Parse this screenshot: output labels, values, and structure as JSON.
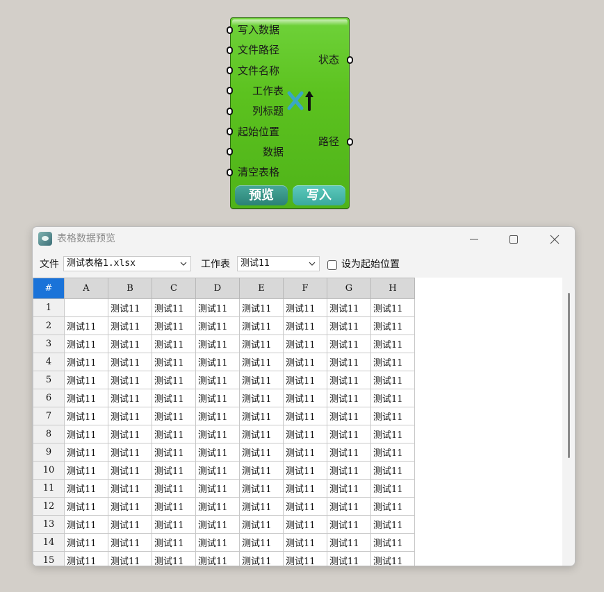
{
  "component": {
    "inputs": [
      "写入数据",
      "文件路径",
      "文件名称",
      "工作表",
      "列标题",
      "起始位置",
      "数据",
      "清空表格"
    ],
    "outputs": [
      "状态",
      "路径"
    ],
    "buttons": {
      "preview": "预览",
      "write": "写入"
    }
  },
  "window": {
    "title": "表格数据预览",
    "file_label": "文件",
    "file_value": "测试表格1.xlsx",
    "sheet_label": "工作表",
    "sheet_value": "测试11",
    "start_checkbox_label": "设为起始位置",
    "start_checkbox_checked": false
  },
  "grid": {
    "corner": "#",
    "columns": [
      "A",
      "B",
      "C",
      "D",
      "E",
      "F",
      "G",
      "H"
    ],
    "rows": [
      {
        "num": "1",
        "cells": [
          "",
          "测试11",
          "测试11",
          "测试11",
          "测试11",
          "测试11",
          "测试11",
          "测试11"
        ]
      },
      {
        "num": "2",
        "cells": [
          "测试11",
          "测试11",
          "测试11",
          "测试11",
          "测试11",
          "测试11",
          "测试11",
          "测试11"
        ]
      },
      {
        "num": "3",
        "cells": [
          "测试11",
          "测试11",
          "测试11",
          "测试11",
          "测试11",
          "测试11",
          "测试11",
          "测试11"
        ]
      },
      {
        "num": "4",
        "cells": [
          "测试11",
          "测试11",
          "测试11",
          "测试11",
          "测试11",
          "测试11",
          "测试11",
          "测试11"
        ]
      },
      {
        "num": "5",
        "cells": [
          "测试11",
          "测试11",
          "测试11",
          "测试11",
          "测试11",
          "测试11",
          "测试11",
          "测试11"
        ]
      },
      {
        "num": "6",
        "cells": [
          "测试11",
          "测试11",
          "测试11",
          "测试11",
          "测试11",
          "测试11",
          "测试11",
          "测试11"
        ]
      },
      {
        "num": "7",
        "cells": [
          "测试11",
          "测试11",
          "测试11",
          "测试11",
          "测试11",
          "测试11",
          "测试11",
          "测试11"
        ]
      },
      {
        "num": "8",
        "cells": [
          "测试11",
          "测试11",
          "测试11",
          "测试11",
          "测试11",
          "测试11",
          "测试11",
          "测试11"
        ]
      },
      {
        "num": "9",
        "cells": [
          "测试11",
          "测试11",
          "测试11",
          "测试11",
          "测试11",
          "测试11",
          "测试11",
          "测试11"
        ]
      },
      {
        "num": "10",
        "cells": [
          "测试11",
          "测试11",
          "测试11",
          "测试11",
          "测试11",
          "测试11",
          "测试11",
          "测试11"
        ]
      },
      {
        "num": "11",
        "cells": [
          "测试11",
          "测试11",
          "测试11",
          "测试11",
          "测试11",
          "测试11",
          "测试11",
          "测试11"
        ]
      },
      {
        "num": "12",
        "cells": [
          "测试11",
          "测试11",
          "测试11",
          "测试11",
          "测试11",
          "测试11",
          "测试11",
          "测试11"
        ]
      },
      {
        "num": "13",
        "cells": [
          "测试11",
          "测试11",
          "测试11",
          "测试11",
          "测试11",
          "测试11",
          "测试11",
          "测试11"
        ]
      },
      {
        "num": "14",
        "cells": [
          "测试11",
          "测试11",
          "测试11",
          "测试11",
          "测试11",
          "测试11",
          "测试11",
          "测试11"
        ]
      },
      {
        "num": "15",
        "cells": [
          "测试11",
          "测试11",
          "测试11",
          "测试11",
          "测试11",
          "测试11",
          "测试11",
          "测试11"
        ]
      }
    ]
  },
  "colors": {
    "component_green": "#5cc21f",
    "corner_blue": "#1a73d9",
    "canvas_bg": "#d3cfc9"
  }
}
